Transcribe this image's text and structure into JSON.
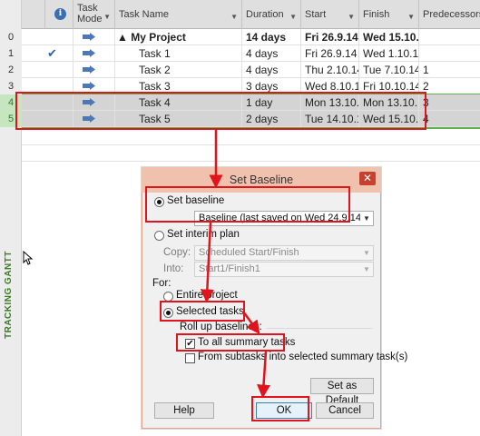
{
  "side_label": "TRACKING GANTT",
  "table": {
    "headers": {
      "task_mode": "Task Mode",
      "task_name": "Task Name",
      "duration": "Duration",
      "start": "Start",
      "finish": "Finish",
      "predecessors": "Predecessors"
    },
    "rows": [
      {
        "id": "0",
        "check": "",
        "name": "▲ My Project",
        "duration": "14 days",
        "start": "Fri 26.9.14",
        "finish": "Wed 15.10.",
        "pred": ""
      },
      {
        "id": "1",
        "check": "✔",
        "name": "Task 1",
        "duration": "4 days",
        "start": "Fri 26.9.14",
        "finish": "Wed 1.10.14",
        "pred": ""
      },
      {
        "id": "2",
        "check": "",
        "name": "Task 2",
        "duration": "4 days",
        "start": "Thu 2.10.14",
        "finish": "Tue 7.10.14",
        "pred": "1"
      },
      {
        "id": "3",
        "check": "",
        "name": "Task 3",
        "duration": "3 days",
        "start": "Wed 8.10.14",
        "finish": "Fri 10.10.14",
        "pred": "2"
      },
      {
        "id": "4",
        "check": "",
        "name": "Task 4",
        "duration": "1 day",
        "start": "Mon 13.10.1",
        "finish": "Mon 13.10.1",
        "pred": "3"
      },
      {
        "id": "5",
        "check": "",
        "name": "Task 5",
        "duration": "2 days",
        "start": "Tue 14.10.1",
        "finish": "Wed 15.10.1",
        "pred": "4"
      }
    ]
  },
  "dialog": {
    "title": "Set Baseline",
    "close": "✕",
    "set_baseline_label": "Set baseline",
    "baseline_value": "Baseline (last saved on Wed 24.9.14)",
    "set_interim_label": "Set interim plan",
    "copy_label": "Copy:",
    "copy_value": "Scheduled Start/Finish",
    "into_label": "Into:",
    "into_value": "Start1/Finish1",
    "for_label": "For:",
    "entire_project_label": "Entire project",
    "selected_tasks_label": "Selected tasks",
    "rollup_label": "Roll up baselines:",
    "to_all_summary_label": "To all summary tasks",
    "from_subtasks_label": "From subtasks into selected summary task(s)",
    "set_as_default": "Set as Default",
    "help": "Help",
    "ok": "OK",
    "cancel": "Cancel"
  },
  "colors": {
    "annotation": "#e0141c",
    "selection_green": "#5fb24e",
    "title_bar": "#f0c2ae"
  }
}
